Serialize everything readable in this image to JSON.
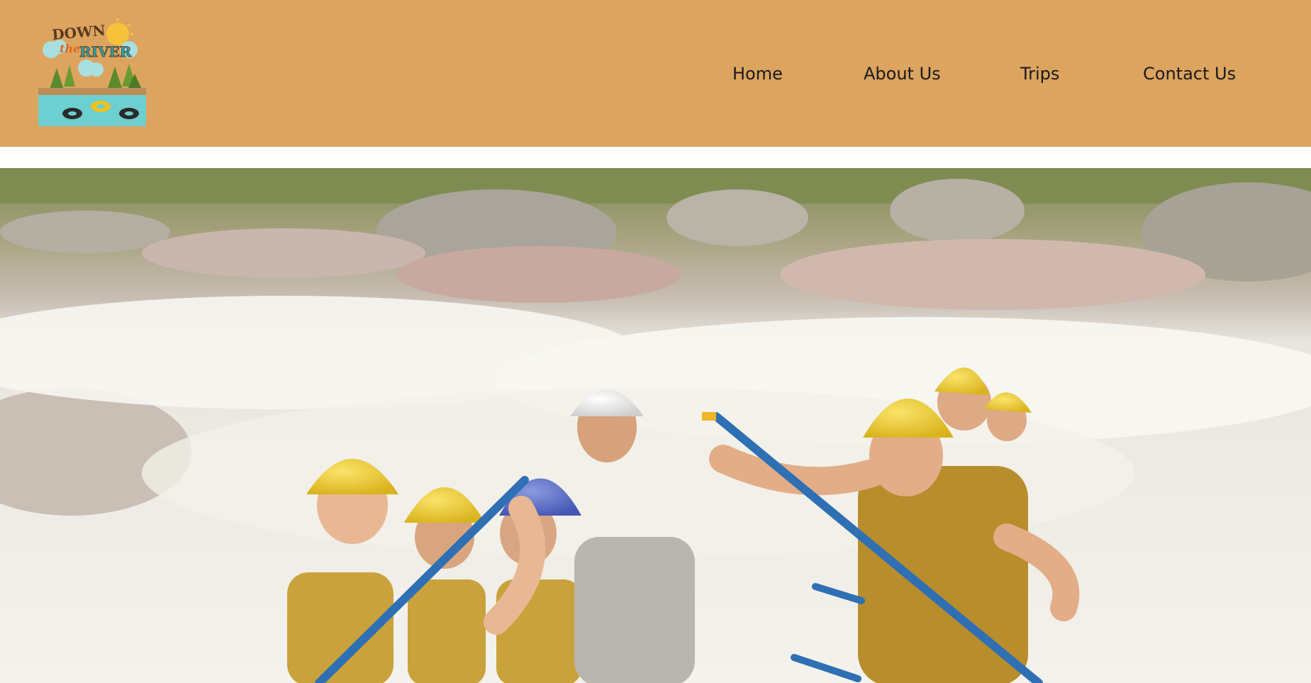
{
  "header": {
    "background_color": "#dca45f",
    "logo": {
      "alt": "Down the River logo",
      "text_line1": "DOWN",
      "text_line2": "the",
      "text_line3": "RIVER"
    }
  },
  "nav": {
    "items": [
      {
        "label": "Home"
      },
      {
        "label": "About Us"
      },
      {
        "label": "Trips"
      },
      {
        "label": "Contact Us"
      }
    ]
  },
  "hero": {
    "image_alt": "Group of rafters in yellow helmets paddling through whitewater rapids",
    "colors": {
      "water": "#f1efe8",
      "rocks": "#c9bfb5",
      "helmet_yellow": "#f0cf32",
      "helmet_blue": "#5a6fc8",
      "paddle_blue": "#2f6fb4"
    }
  }
}
